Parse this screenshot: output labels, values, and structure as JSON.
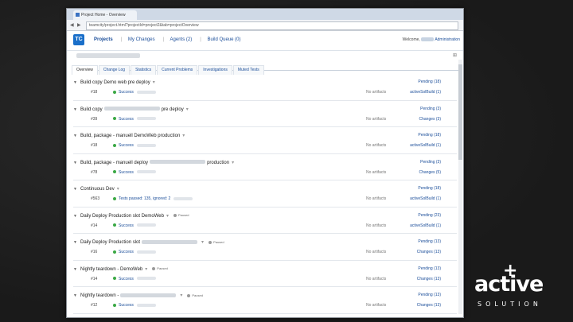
{
  "browser": {
    "tab_title": "Project Home - Overview",
    "url": "teamcity/project.html?projectId=project2&tab=projectOverview",
    "nav_back": "◀",
    "nav_fwd": "▶"
  },
  "app": {
    "logo": "TC",
    "nav": {
      "projects": "Projects",
      "my_changes": "My Changes",
      "agents": "Agents (2)",
      "build_queue": "Build Queue (0)"
    },
    "welcome": "Welcome,",
    "admin": "Administration"
  },
  "subtabs": [
    "Overview",
    "Change Log",
    "Statistics",
    "Current Problems",
    "Investigations",
    "Muted Tests"
  ],
  "builds": [
    {
      "pre": "Build copy Demo web pre deploy",
      "post": "",
      "num": "#18",
      "status": "Success",
      "artifacts": "No artifacts",
      "queue": "Pending (18)",
      "changes": "activeSolBuild (1)",
      "paused": ""
    },
    {
      "pre": "Build copy",
      "post": "pre deploy",
      "num": "#39",
      "status": "Success",
      "artifacts": "No artifacts",
      "queue": "Pending (3)",
      "changes": "Changes (3)",
      "paused": ""
    },
    {
      "pre": "Build, package - manuell DemoWeb production",
      "post": "",
      "num": "#18",
      "status": "Success",
      "artifacts": "No artifacts",
      "queue": "Pending (18)",
      "changes": "activeSolBuild (1)",
      "paused": ""
    },
    {
      "pre": "Build, package - manuell deploy",
      "post": "production",
      "num": "#78",
      "status": "Success",
      "artifacts": "No artifacts",
      "queue": "Pending (3)",
      "changes": "Changes (5)",
      "paused": ""
    },
    {
      "pre": "Continuous Dev",
      "post": "",
      "num": "#563",
      "status": "Tests passed: 135, ignored: 2",
      "artifacts": "No artifacts",
      "queue": "Pending (18)",
      "changes": "activeSolBuild (1)",
      "paused": ""
    },
    {
      "pre": "Daily Deploy Production slot DemoWeb",
      "post": "",
      "num": "#14",
      "status": "Success",
      "artifacts": "No artifacts",
      "queue": "Pending (23)",
      "changes": "activeSolBuild (1)",
      "paused": "Paused"
    },
    {
      "pre": "Daily Deploy Production slot",
      "post": "",
      "num": "#16",
      "status": "Success",
      "artifacts": "No artifacts",
      "queue": "Pending (13)",
      "changes": "Changes (13)",
      "paused": "Paused"
    },
    {
      "pre": "Nightly teardown - DemoWeb",
      "post": "",
      "num": "#14",
      "status": "Success",
      "artifacts": "No artifacts",
      "queue": "Pending (13)",
      "changes": "Changes (13)",
      "paused": "Paused"
    },
    {
      "pre": "Nightly teardown -",
      "post": "",
      "num": "#12",
      "status": "Success",
      "artifacts": "No artifacts",
      "queue": "Pending (13)",
      "changes": "Changes (13)",
      "paused": "Paused"
    }
  ],
  "brand": {
    "main": "active",
    "plus": "+",
    "sub": "SOLUTION"
  }
}
